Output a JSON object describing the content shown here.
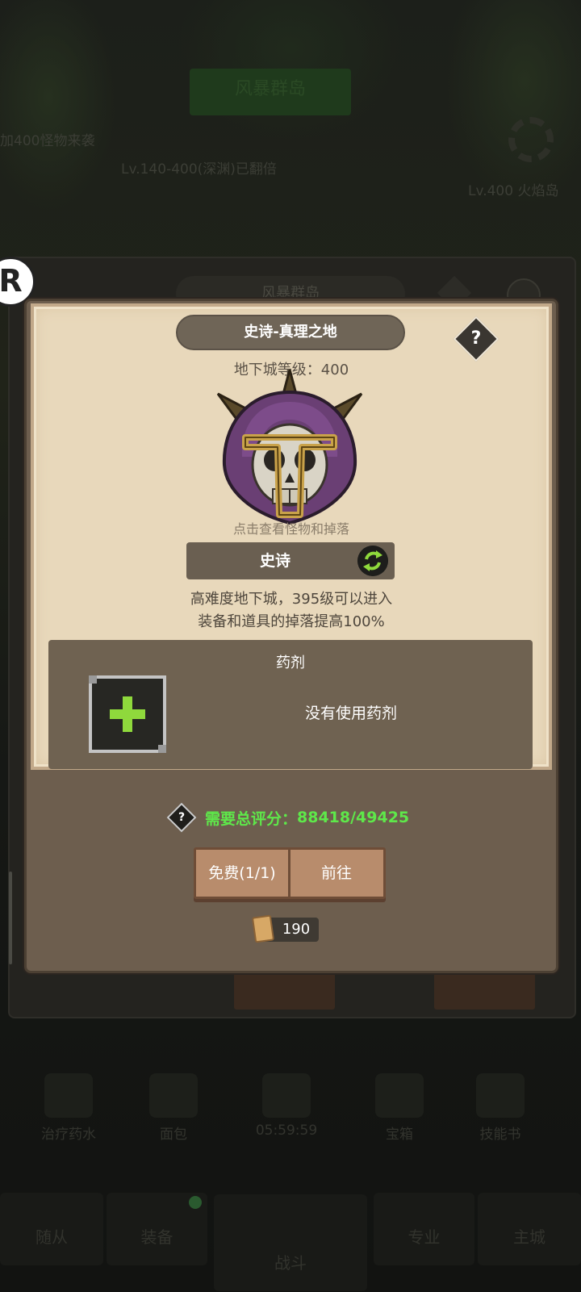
{
  "background": {
    "green_button_text": "风暴群岛",
    "left_text": "加400怪物来袭",
    "mid_text": "Lv.140-400(深渊)已翻倍",
    "right_text": "Lv.400 火焰岛",
    "outer_header": "风暴群岛",
    "tabs": [
      "治疗药水",
      "面包",
      "05:59:59",
      "宝箱",
      "技能书"
    ],
    "nav": [
      "随从",
      "装备",
      "战斗",
      "专业",
      "主城"
    ]
  },
  "dungeon": {
    "title": "史诗-真理之地",
    "help_icon": "?",
    "level_text": "地下城等级：400",
    "boss_hint": "点击查看怪物和掉落",
    "difficulty": "史诗",
    "desc_line1": "高难度地下城，395级可以进入",
    "desc_line2": "装备和道具的掉落提高100%"
  },
  "potion": {
    "title": "药剂",
    "empty_text": "没有使用药剂"
  },
  "requirement": {
    "label": "需要总评分：",
    "value": "88418/49425",
    "help_icon": "?"
  },
  "actions": {
    "free_label": "免费(1/1)",
    "go_label": "前往"
  },
  "cost": {
    "value": "190"
  },
  "colors": {
    "accent_green": "#5ee84a",
    "plus_green": "#8fd93c",
    "parchment": "#e8d8bb",
    "modal": "#6d5e4e"
  }
}
